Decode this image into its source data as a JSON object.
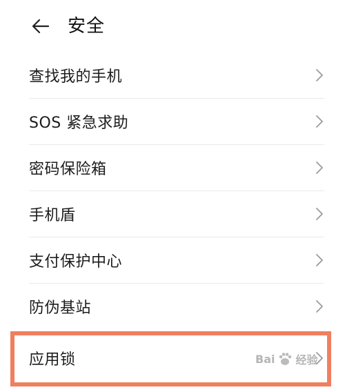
{
  "header": {
    "back_icon": "arrow-left-icon",
    "title": "安全"
  },
  "list": {
    "items": [
      {
        "label": "查找我的手机"
      },
      {
        "label": "SOS 紧急求助"
      },
      {
        "label": "密码保险箱"
      },
      {
        "label": "手机盾"
      },
      {
        "label": "支付保护中心"
      },
      {
        "label": "防伪基站"
      },
      {
        "label": "应用锁",
        "highlighted": true
      }
    ],
    "chevron_icon": "chevron-right-icon"
  },
  "highlight_color": "#f07f5f",
  "watermark": {
    "text": "Bai",
    "text2": "经验"
  }
}
